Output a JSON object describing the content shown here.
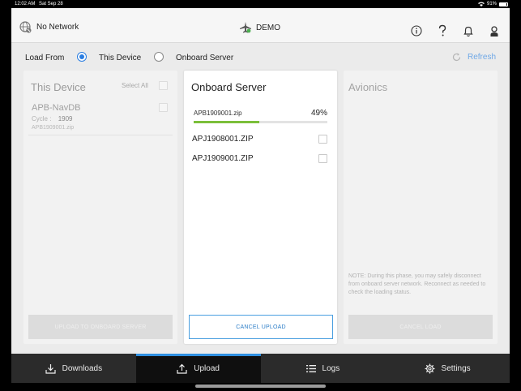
{
  "statusbar": {
    "time": "12:02 AM",
    "date": "Sat Sep 28",
    "battery": "91%"
  },
  "header": {
    "network": "No Network",
    "brand": "DEMO"
  },
  "load_from": {
    "label": "Load From",
    "opt_device": "This Device",
    "opt_server": "Onboard Server",
    "selected": "This Device",
    "refresh": "Refresh"
  },
  "device_panel": {
    "title": "This Device",
    "select_all": "Select All",
    "item": {
      "name": "APB-NavDB",
      "cycle_label": "Cycle :",
      "cycle_value": "1909",
      "file": "APB1909001.zip"
    },
    "button": "UPLOAD TO ONBOARD SERVER"
  },
  "server_panel": {
    "title": "Onboard Server",
    "upload": {
      "file": "APB1909001.zip",
      "percent_text": "49%",
      "progress": 0.49
    },
    "files": [
      "APJ1908001.ZIP",
      "APJ1909001.ZIP"
    ],
    "button": "CANCEL UPLOAD"
  },
  "avionics_panel": {
    "title": "Avionics",
    "note": "NOTE: During this phase, you may safely disconnect from onboard server network. Reconnect as needed to check the loading status.",
    "button": "CANCEL LOAD"
  },
  "tabs": {
    "downloads": "Downloads",
    "upload": "Upload",
    "logs": "Logs",
    "settings": "Settings",
    "selected": "Upload"
  },
  "colors": {
    "accent": "#2a7de1",
    "progress": "#7bbf3a",
    "tabbar": "#2b2b2b"
  }
}
